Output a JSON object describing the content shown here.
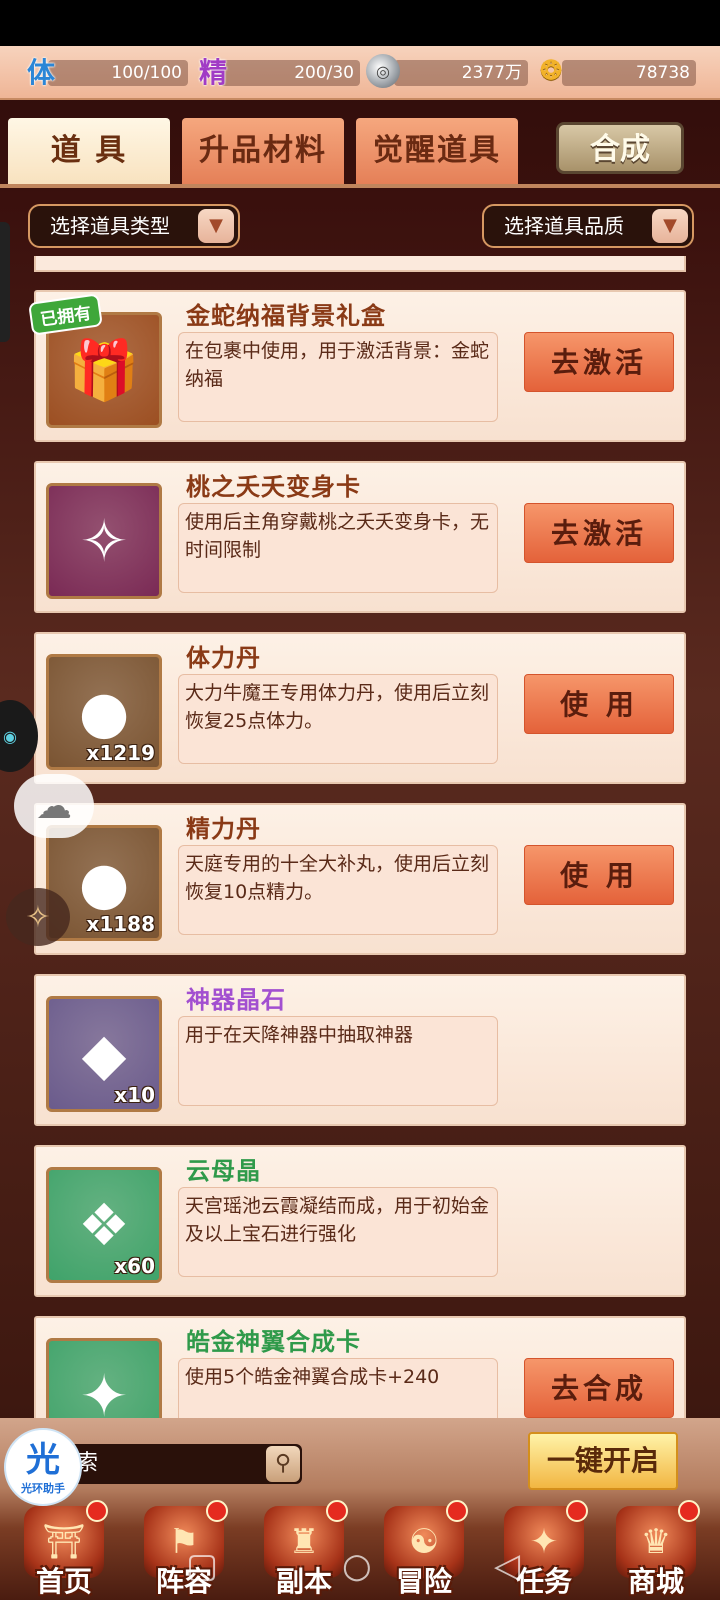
{
  "resources": {
    "stamina": {
      "icon": "体",
      "value": "100/100"
    },
    "energy": {
      "icon": "精",
      "value": "200/30"
    },
    "silver": {
      "icon": "coin-icon",
      "value": "2377万"
    },
    "gold": {
      "icon": "ingot-icon",
      "value": "78738"
    }
  },
  "tabs": [
    {
      "label": "道 具"
    },
    {
      "label": "升品材料"
    },
    {
      "label": "觉醒道具"
    }
  ],
  "compose_label": "合成",
  "filters": {
    "type_label": "选择道具类型",
    "quality_label": "选择道具品质"
  },
  "items": [
    {
      "title": "金蛇纳福背景礼盒",
      "title_color": "#8a3a16",
      "desc": "在包裹中使用，用于激活背景：金蛇纳福",
      "action": "去激活",
      "owned": "已拥有",
      "icon": "gift-box-icon",
      "icon_bg": "#9c4f22"
    },
    {
      "title": "桃之夭夭变身卡",
      "title_color": "#8a3a16",
      "desc": "使用后主角穿戴桃之夭夭变身卡，无时间限制",
      "action": "去激活",
      "icon": "transform-card-icon",
      "icon_bg": "#7a2a55"
    },
    {
      "title": "体力丹",
      "title_color": "#8a3a16",
      "desc": "大力牛魔王专用体力丹，使用后立刻恢复25点体力。",
      "action": "使 用",
      "qty": "x1219",
      "icon": "blue-pill-icon",
      "icon_bg": "#7a5432"
    },
    {
      "title": "精力丹",
      "title_color": "#8a3a16",
      "desc": "天庭专用的十全大补丸，使用后立刻恢复10点精力。",
      "action": "使 用",
      "qty": "x1188",
      "icon": "purple-pill-icon",
      "icon_bg": "#7a5432"
    },
    {
      "title": "神器晶石",
      "title_color": "#a24fd0",
      "desc": "用于在天降神器中抽取神器",
      "qty": "x10",
      "icon": "gold-crystal-icon",
      "icon_bg": "#6a5b8c"
    },
    {
      "title": "云母晶",
      "title_color": "#2f9a4a",
      "desc": "天宫瑶池云霞凝结而成，用于初始金及以上宝石进行强化",
      "qty": "x60",
      "icon": "purple-crystal-icon",
      "icon_bg": "#3fa36a"
    },
    {
      "title": "皓金神翼合成卡",
      "title_color": "#2f9a4a",
      "desc": "使用5个皓金神翼合成卡+240",
      "action": "去合成",
      "icon": "wing-card-icon",
      "icon_bg": "#3fa36a"
    }
  ],
  "search": {
    "text": "索"
  },
  "helper": {
    "char": "光",
    "label": "光环助手"
  },
  "open_all": "一键开启",
  "nav": [
    {
      "label": "首页",
      "glyph": "⛩"
    },
    {
      "label": "阵容",
      "glyph": "⚑"
    },
    {
      "label": "副本",
      "glyph": "♜"
    },
    {
      "label": "冒险",
      "glyph": "☯"
    },
    {
      "label": "任务",
      "glyph": "✦"
    },
    {
      "label": "商城",
      "glyph": "♛"
    }
  ]
}
